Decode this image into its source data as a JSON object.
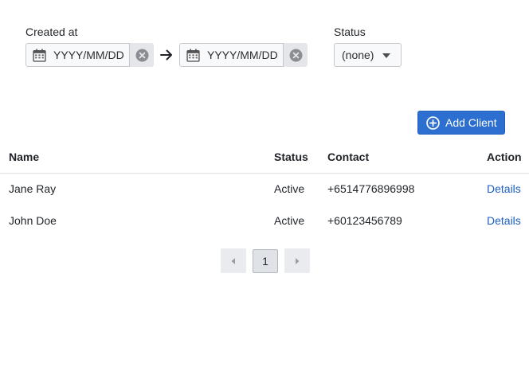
{
  "filters": {
    "created_at_label": "Created at",
    "date_from_placeholder": "YYYY/MM/DD",
    "date_to_placeholder": "YYYY/MM/DD",
    "status_label": "Status",
    "status_value": "(none)"
  },
  "actions": {
    "add_client_label": "Add Client"
  },
  "table": {
    "headers": {
      "name": "Name",
      "status": "Status",
      "contact": "Contact",
      "action": "Action"
    },
    "rows": [
      {
        "name": "Jane Ray",
        "status": "Active",
        "contact": "+6514776896998",
        "action": "Details"
      },
      {
        "name": "John Doe",
        "status": "Active",
        "contact": "+60123456789",
        "action": "Details"
      }
    ]
  },
  "pagination": {
    "current_page": "1"
  },
  "icons": {
    "calendar": "calendar-icon",
    "clear": "clear-icon",
    "arrow": "arrow-right-icon",
    "add": "plus-circle-icon",
    "prev": "chevron-left-icon",
    "next": "chevron-right-icon"
  },
  "colors": {
    "primary": "#2c6fd1",
    "link": "#1f5fbf"
  }
}
